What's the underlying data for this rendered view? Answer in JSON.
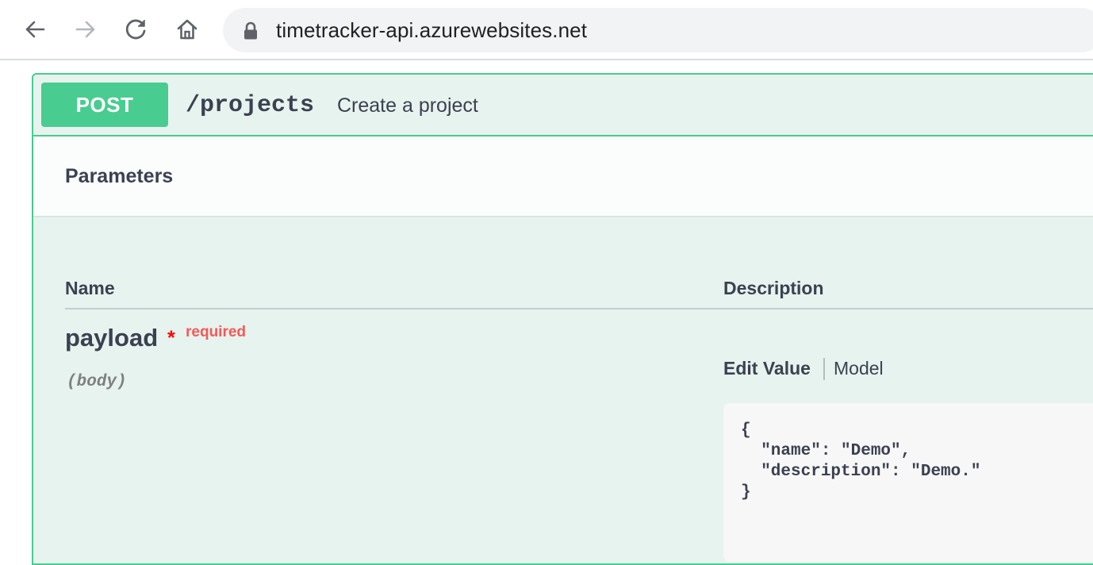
{
  "browser": {
    "url": "timetracker-api.azurewebsites.net",
    "icons": [
      "back-arrow-icon",
      "forward-arrow-icon",
      "reload-icon",
      "home-icon",
      "lock-icon"
    ]
  },
  "operation": {
    "method": "POST",
    "path": "/projects",
    "summary": "Create a project",
    "color": "#49cc90"
  },
  "parameters": {
    "title": "Parameters",
    "columns": {
      "name": "Name",
      "description": "Description"
    },
    "items": [
      {
        "name": "payload",
        "star": "*",
        "required_label": "required",
        "in": "(body)",
        "tabs": {
          "edit": "Edit Value",
          "model": "Model"
        },
        "value": "{\n  \"name\": \"Demo\",\n  \"description\": \"Demo.\"\n}"
      }
    ]
  }
}
